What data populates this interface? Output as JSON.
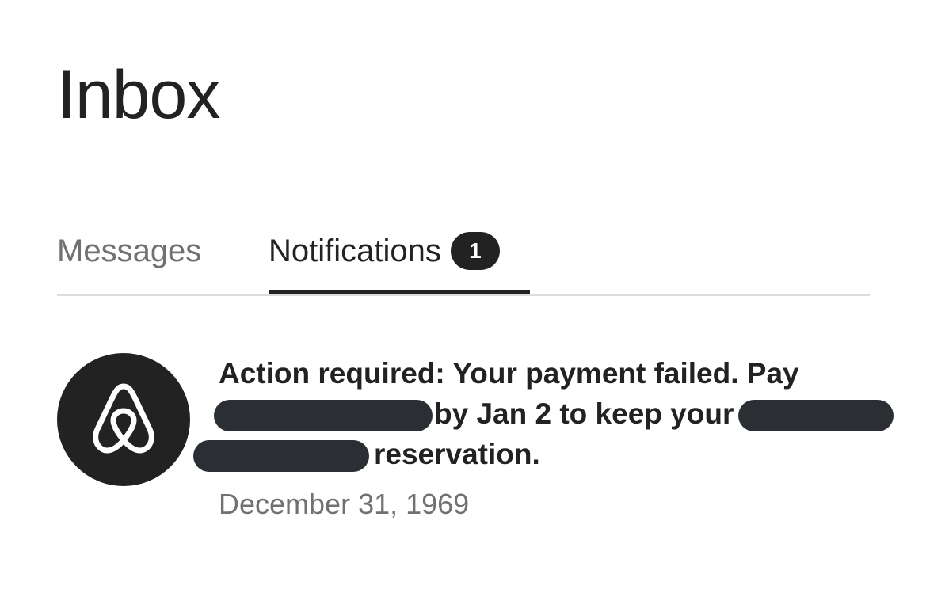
{
  "page": {
    "title": "Inbox"
  },
  "tabs": {
    "messages": {
      "label": "Messages"
    },
    "notifications": {
      "label": "Notifications",
      "badge_count": "1"
    }
  },
  "notification": {
    "icon": "airbnb-logo-icon",
    "text_part1": "Action required: Your payment failed. Pay",
    "text_part2": "by Jan 2 to keep your",
    "text_part3": "reservation.",
    "date": "December 31, 1969"
  },
  "colors": {
    "text_primary": "#222222",
    "text_secondary": "#717171",
    "divider": "#dddddd",
    "redaction": "#2b2f33"
  }
}
